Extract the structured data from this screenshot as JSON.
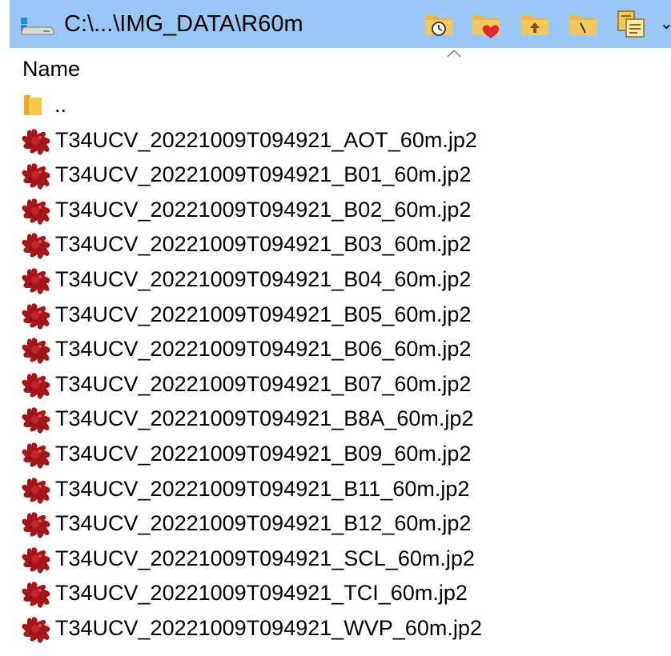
{
  "pathbar": {
    "path": "C:\\...\\IMG_DATA\\R60m",
    "accent_color": "#99c6f5",
    "tool_icons": [
      "recent-folders-icon",
      "favorite-folders-icon",
      "parent-folder-icon",
      "root-folder-icon",
      "copy-path-icon"
    ],
    "more_glyph": "⌄"
  },
  "header": {
    "name_label": "Name",
    "sort_direction": "ascending"
  },
  "list": {
    "parent_label": "..",
    "files": [
      "T34UCV_20221009T094921_AOT_60m.jp2",
      "T34UCV_20221009T094921_B01_60m.jp2",
      "T34UCV_20221009T094921_B02_60m.jp2",
      "T34UCV_20221009T094921_B03_60m.jp2",
      "T34UCV_20221009T094921_B04_60m.jp2",
      "T34UCV_20221009T094921_B05_60m.jp2",
      "T34UCV_20221009T094921_B06_60m.jp2",
      "T34UCV_20221009T094921_B07_60m.jp2",
      "T34UCV_20221009T094921_B8A_60m.jp2",
      "T34UCV_20221009T094921_B09_60m.jp2",
      "T34UCV_20221009T094921_B11_60m.jp2",
      "T34UCV_20221009T094921_B12_60m.jp2",
      "T34UCV_20221009T094921_SCL_60m.jp2",
      "T34UCV_20221009T094921_TCI_60m.jp2",
      "T34UCV_20221009T094921_WVP_60m.jp2"
    ],
    "file_icon": "jp2-file-icon",
    "file_icon_color": "#a3161a"
  }
}
